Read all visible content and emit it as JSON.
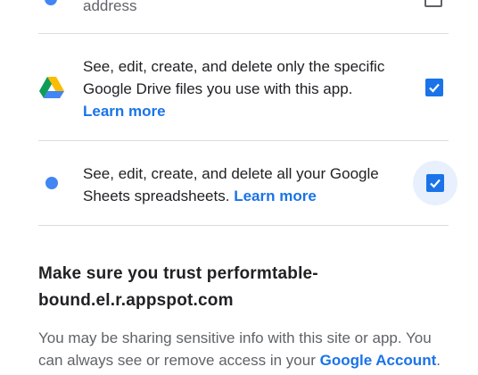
{
  "permissions": [
    {
      "text_line": "address",
      "checked": false
    },
    {
      "text": "See, edit, create, and delete only the specific Google Drive files you use with this app.",
      "link": "Learn more",
      "icon": "google-drive-icon",
      "checked": true
    },
    {
      "text": "See, edit, create, and delete all your Google Sheets spreadsheets.",
      "link": "Learn more",
      "icon": "blue-dot-icon",
      "checked": true,
      "focused": true
    }
  ],
  "trust": {
    "heading": "Make sure you trust performtable-bound.el.r.appspot.com",
    "body": "You may be sharing sensitive info with this site or app. You can always see or remove access in your",
    "link": "Google Account",
    "period": "."
  },
  "colors": {
    "accent": "#1a73e8",
    "divider": "#dadce0",
    "focus": "#e8f0fe"
  }
}
